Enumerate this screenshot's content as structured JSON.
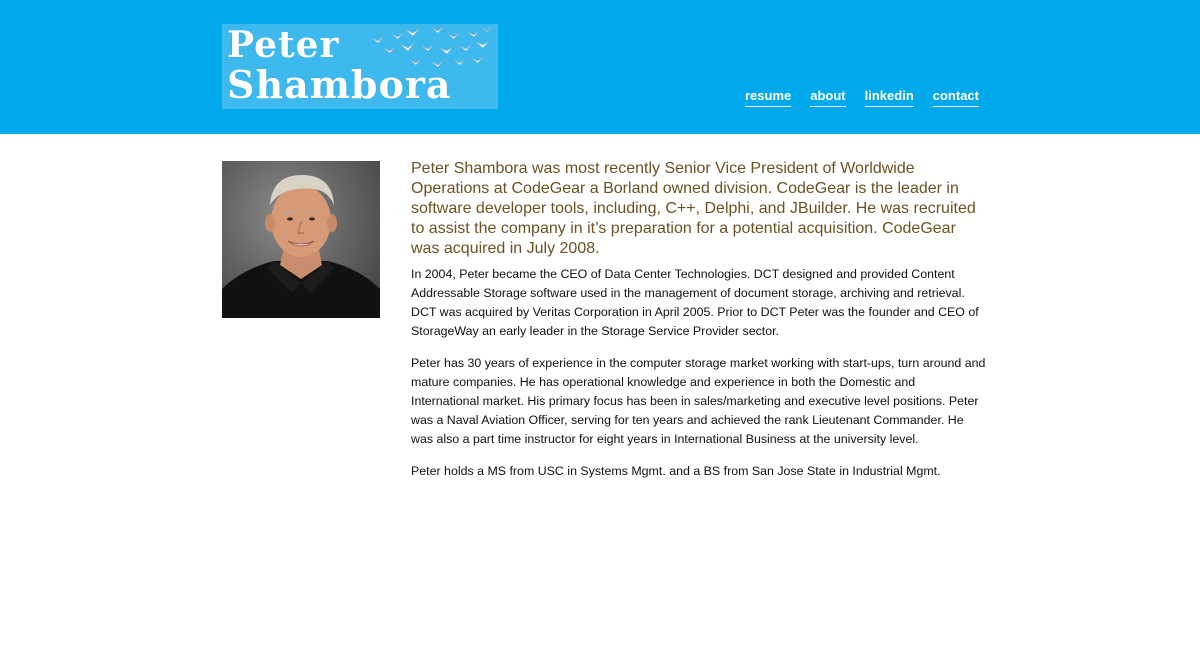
{
  "header": {
    "logo_line1": "Peter",
    "logo_line2": "Shambora",
    "bg_color": "#00a9eb"
  },
  "nav": {
    "items": [
      {
        "label": "resume"
      },
      {
        "label": "about"
      },
      {
        "label": "linkedin"
      },
      {
        "label": "contact"
      }
    ]
  },
  "main": {
    "intro": "Peter Shambora was most recently Senior Vice President of Worldwide Operations at CodeGear a Borland owned division. CodeGear is the leader in software developer tools, including, C++, Delphi, and JBuilder. He was recruited to assist the company in it’s preparation for a potential acquisition. CodeGear was acquired in July 2008.",
    "paragraphs": [
      "In 2004, Peter became the CEO of Data Center Technologies. DCT designed and provided Content Addressable Storage software used in the management of document storage, archiving and retrieval. DCT was acquired by Veritas Corporation in April 2005. Prior to DCT Peter was the founder and CEO of StorageWay an early leader in the Storage Service Provider sector.",
      "Peter has 30 years of experience in the computer storage market working with start-ups, turn around and mature companies. He has operational knowledge and experience in both the Domestic and International market. His primary focus has been in sales/marketing and executive level positions. Peter was a Naval Aviation Officer, serving for ten years and achieved the rank Lieutenant Commander. He was also a part time instructor for eight years in International Business at the university level.",
      "Peter holds a MS from USC in Systems Mgmt. and a BS from San Jose State in Industrial Mgmt."
    ],
    "intro_color": "#6b5222"
  }
}
